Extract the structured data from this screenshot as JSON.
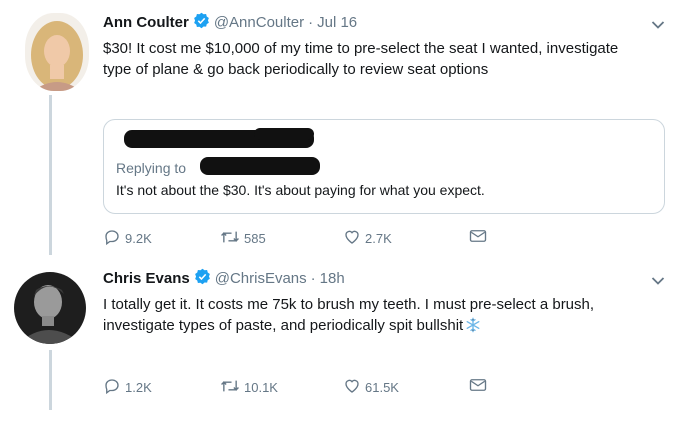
{
  "tweets": [
    {
      "name": "Ann Coulter",
      "handle": "@AnnCoulter",
      "separator": "·",
      "time": "Jul 16",
      "text": "$30! It cost me $10,000 of my time to pre-select the seat I wanted, investigate type of plane & go back periodically to review seat options",
      "quote": {
        "replying": "Replying to",
        "text": "It's not about the $30. It's about paying for what you expect."
      },
      "replies": "9.2K",
      "retweets": "585",
      "likes": "2.7K"
    },
    {
      "name": "Chris Evans",
      "handle": "@ChrisEvans",
      "separator": "·",
      "time": "18h",
      "text": "I totally get it. It costs me 75k to brush my teeth. I must pre-select a brush, investigate types of paste, and periodically spit bullshit",
      "emoji": "❄",
      "replies": "1.2K",
      "retweets": "10.1K",
      "likes": "61.5K"
    }
  ],
  "colors": {
    "verified": "#1da1f2",
    "muted": "#657786",
    "text": "#14171a",
    "border": "#ccd6dd"
  },
  "icons": [
    "verified-badge-icon",
    "chevron-down-icon",
    "reply-icon",
    "retweet-icon",
    "like-icon",
    "message-icon",
    "snowflake-emoji-icon"
  ]
}
